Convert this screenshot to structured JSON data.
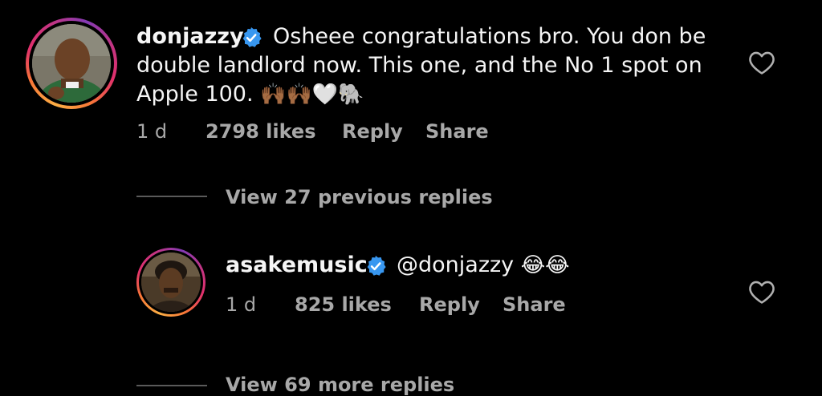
{
  "comment": {
    "username": "donjazzy",
    "text": "Osheee congratulations bro. You don be double landlord now. This one, and the No 1 spot on Apple 100.",
    "emojis": "🙌🏾🙌🏾🤍🐘",
    "age": "1 d",
    "likes": "2798 likes",
    "reply_label": "Reply",
    "share_label": "Share",
    "verified_icon": "verified-badge-icon",
    "like_icon": "heart-outline-icon"
  },
  "view_previous": {
    "label": "View 27 previous replies"
  },
  "reply": {
    "username": "asakemusic",
    "mention": "@donjazzy",
    "emojis": "😂😂",
    "age": "1 d",
    "likes": "825 likes",
    "reply_label": "Reply",
    "share_label": "Share"
  },
  "view_more": {
    "label": "View 69 more replies"
  },
  "colors": {
    "background": "#000000",
    "text": "#f5f5f5",
    "muted": "#a8a8a8",
    "verified": "#3897f0"
  }
}
